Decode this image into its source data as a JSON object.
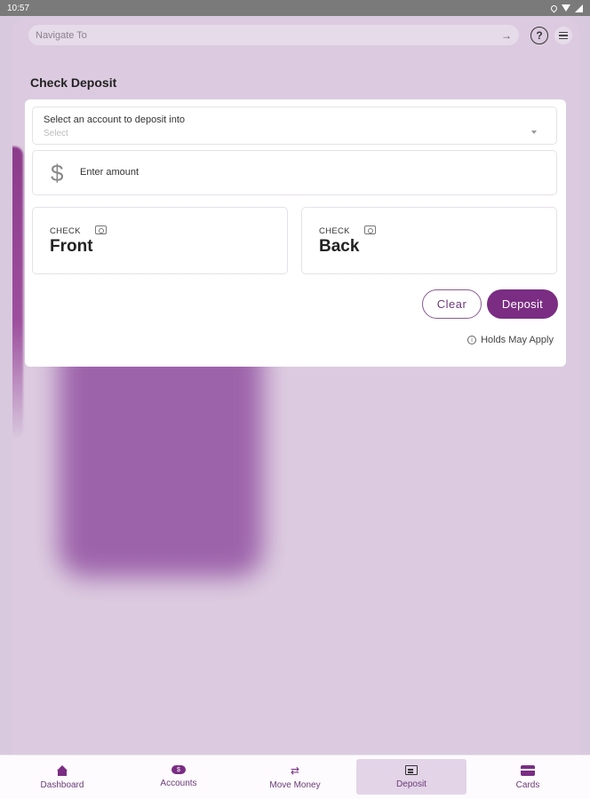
{
  "status_bar": {
    "time": "10:57"
  },
  "header": {
    "nav_placeholder": "Navigate To",
    "nav_arrow": "→",
    "help_glyph": "?"
  },
  "page": {
    "title": "Check Deposit"
  },
  "form": {
    "account_label": "Select an account to deposit into",
    "account_placeholder": "Select",
    "amount_symbol": "$",
    "amount_placeholder": "Enter amount",
    "check_front": {
      "label": "CHECK",
      "side": "Front"
    },
    "check_back": {
      "label": "CHECK",
      "side": "Back"
    },
    "clear_label": "Clear",
    "deposit_label": "Deposit",
    "holds_text": "Holds May Apply",
    "info_glyph": "i"
  },
  "bottom_nav": {
    "items": [
      {
        "label": "Dashboard",
        "icon": "home-icon"
      },
      {
        "label": "Accounts",
        "icon": "accounts-icon",
        "glyph": "$"
      },
      {
        "label": "Move Money",
        "icon": "transfer-icon",
        "glyph": "⇄"
      },
      {
        "label": "Deposit",
        "icon": "deposit-check-icon",
        "active": true
      },
      {
        "label": "Cards",
        "icon": "card-icon"
      }
    ]
  },
  "colors": {
    "accent": "#7a2d83",
    "background": "#dccbe0",
    "active_tab": "#e3d4e8"
  }
}
